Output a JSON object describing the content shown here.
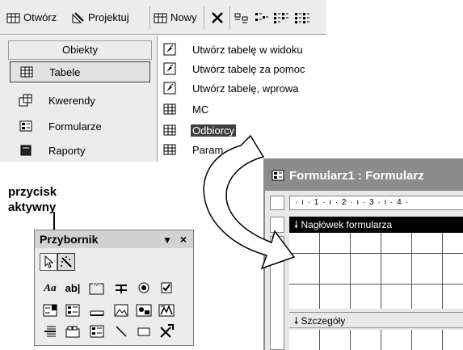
{
  "toolbar": {
    "open_label": "Otwórz",
    "design_label": "Projektuj",
    "new_label": "Nowy"
  },
  "objects": {
    "header": "Obiekty",
    "items": [
      {
        "label": "Tabele",
        "icon": "table-icon"
      },
      {
        "label": "Kwerendy",
        "icon": "query-icon"
      },
      {
        "label": "Formularze",
        "icon": "form-icon"
      },
      {
        "label": "Raporty",
        "icon": "report-icon"
      }
    ]
  },
  "list": {
    "items": [
      {
        "label": "Utwórz tabelę w widoku",
        "icon": "wizard-icon"
      },
      {
        "label": "Utwórz tabelę za pomoc",
        "icon": "wizard-icon"
      },
      {
        "label": "Utwórz tabelę, wprowa",
        "icon": "wizard-icon"
      },
      {
        "label": "MC",
        "icon": "table-icon"
      },
      {
        "label": "Odbiorcy",
        "icon": "table-icon"
      },
      {
        "label": "Param",
        "icon": "table-icon"
      }
    ]
  },
  "callout": {
    "line1": "przycisk",
    "line2": "aktywny"
  },
  "toolbox": {
    "title": "Przybornik",
    "arrow": "▼",
    "close": "×",
    "label_tool": "Aa",
    "textbox_tool": "ab|"
  },
  "form_window": {
    "title": "Formularz1 : Formularz",
    "ruler": "· ı · 1 · ı · 2 · ı · 3 · ı · 4 ·",
    "header_section": "Nagłówek formularza",
    "detail_section": "Szczegóły"
  },
  "colors": {
    "selection": "#3d3d3d",
    "title_bar": "#8c8c8c",
    "panel": "#ececec"
  }
}
